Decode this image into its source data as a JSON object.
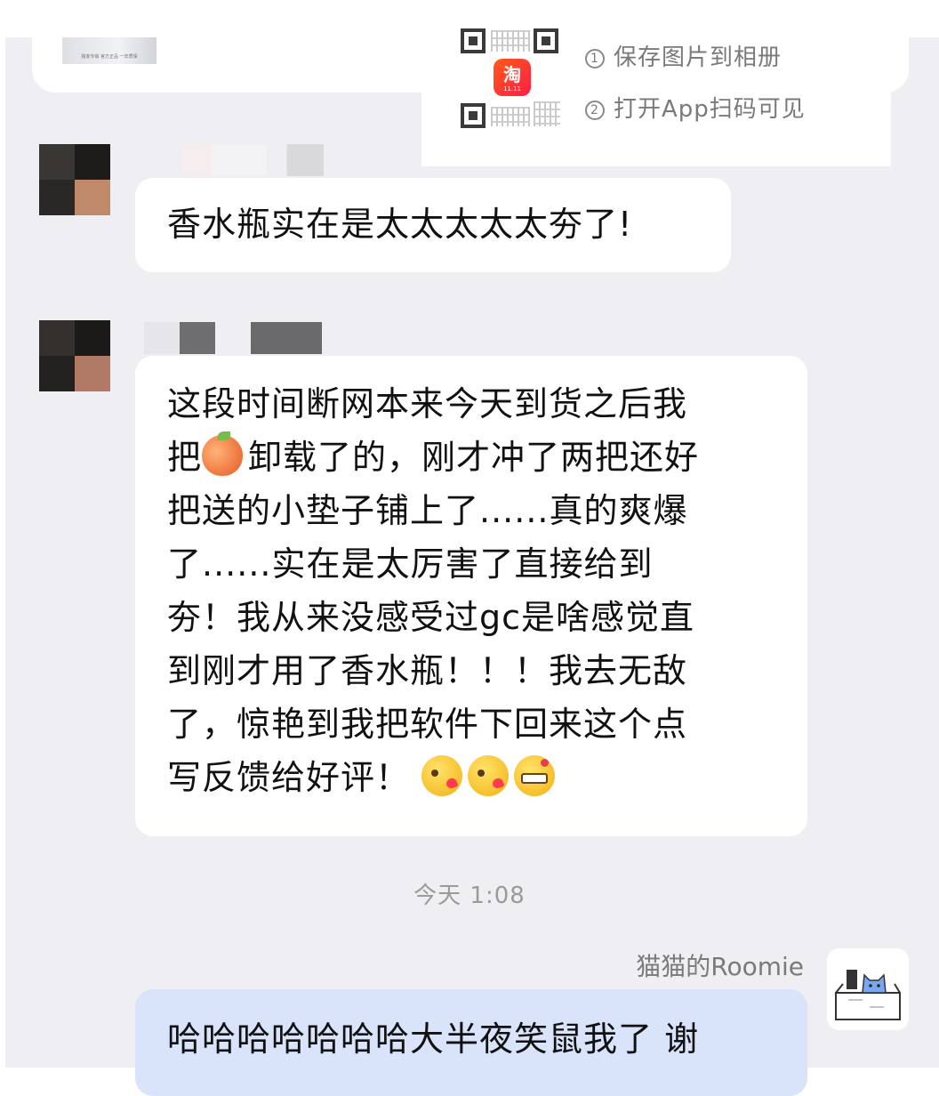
{
  "shared_card": {
    "product_thumb_label": "独家专销  官方正品 一年质保",
    "qr_steps": [
      {
        "num": "1",
        "text": "保存图片到相册"
      },
      {
        "num": "2",
        "text": "打开App扫码可见"
      }
    ],
    "app_logo_text": "淘",
    "app_logo_sub": "11.11"
  },
  "messages": [
    {
      "sender": "other",
      "text": "香水瓶实在是太太太太太夯了!"
    },
    {
      "sender": "other",
      "lines": [
        "这段时间断网本来今天到货之后我",
        "卸载了的，刚才冲了两把还好",
        "把送的小垫子铺上了......真的爽爆",
        "了......实在是太厉害了直接给到",
        "夯！我从来没感受过gc是啥感觉直",
        "到刚才用了香水瓶！！！我去无敌",
        "了，惊艳到我把软件下回来这个点",
        "写反馈给好评！"
      ],
      "line2_prefix": "把",
      "emojis": [
        "peach",
        "kissing-heart",
        "laughing-tears"
      ]
    }
  ],
  "timestamp": "今天 1:08",
  "self": {
    "name": "猫猫的Roomie",
    "message": "哈哈哈哈哈哈哈大半夜笑鼠我了 谢"
  },
  "colors": {
    "chat_background": "#eeeef3",
    "bubble_other": "#ffffff",
    "bubble_self": "#d9e4fb",
    "timestamp_text": "#9a9a9a",
    "app_logo": "#ff3a2f"
  }
}
